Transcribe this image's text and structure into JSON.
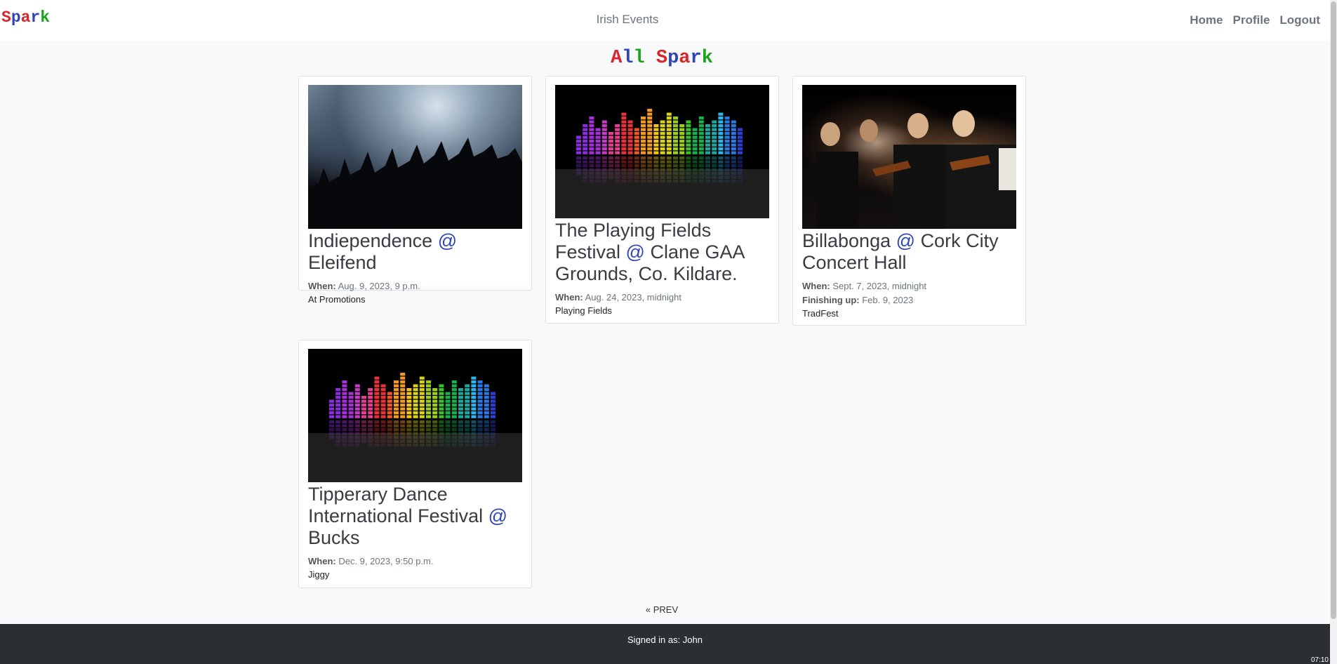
{
  "navbar": {
    "brand_letters": [
      "S",
      "p",
      "a",
      "r",
      "k"
    ],
    "brand_colors": [
      "#d8262c",
      "#2f44b8",
      "#d8262c",
      "#2f44b8",
      "#1aa61a"
    ],
    "center_text": "Irish Events",
    "links": [
      {
        "label": "Home"
      },
      {
        "label": "Profile"
      },
      {
        "label": "Logout"
      }
    ]
  },
  "page_title": {
    "word1": "All",
    "word2": "Spark",
    "word1_colors": [
      "#d8262c",
      "#2f44b8",
      "#1aa61a"
    ],
    "word2_colors": [
      "#d8262c",
      "#2f44b8",
      "#d8262c",
      "#2f44b8",
      "#1aa61a"
    ]
  },
  "events": [
    {
      "title_main": "Indiependence",
      "at": "@",
      "venue": "Eleifend",
      "when_label": "When:",
      "when": "Aug. 9, 2023, 9 p.m.",
      "organizer": "At Promotions",
      "image": "concert-crowd"
    },
    {
      "title_main": "The Playing Fields Festival",
      "at": "@",
      "venue": "Clane GAA Grounds, Co. Kildare.",
      "when_label": "When:",
      "when": "Aug. 24, 2023, midnight",
      "organizer": "Playing Fields",
      "image": "equalizer"
    },
    {
      "title_main": "Billabonga",
      "at": "@",
      "venue": "Cork City Concert Hall",
      "when_label": "When:",
      "when": "Sept. 7, 2023, midnight",
      "finish_label": "Finishing up:",
      "finish": "Feb. 9, 2023",
      "organizer": "TradFest",
      "image": "orchestra"
    },
    {
      "title_main": "Tipperary Dance International Festival",
      "at": "@",
      "venue": "Bucks",
      "when_label": "When:",
      "when": "Dec. 9, 2023, 9:50 p.m.",
      "organizer": "Jiggy",
      "image": "equalizer"
    }
  ],
  "pager": {
    "prev_label": "« PREV"
  },
  "footer": {
    "signed_in": "Signed in as: John"
  },
  "clock": "07:10"
}
